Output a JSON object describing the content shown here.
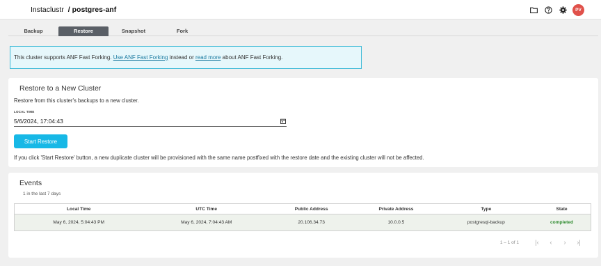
{
  "header": {
    "brand": "Instaclustr",
    "separator": "/",
    "cluster_name": "postgres-anf",
    "avatar_initials": "PV",
    "icons": [
      "folder-icon",
      "help-icon",
      "gear-icon"
    ]
  },
  "tabs": [
    {
      "label": "Backup",
      "active": false
    },
    {
      "label": "Restore",
      "active": true
    },
    {
      "label": "Snapshot",
      "active": false
    },
    {
      "label": "Fork",
      "active": false
    }
  ],
  "banner": {
    "text_1": "This cluster supports ANF Fast Forking. ",
    "link_1": "Use ANF Fast Forking",
    "text_2": " instead or ",
    "link_2": "read more",
    "text_3": " about ANF Fast Forking."
  },
  "restore": {
    "title": "Restore to a New Cluster",
    "subtitle": "Restore from this cluster's backups to a new cluster.",
    "time_label": "LOCAL TIME",
    "time_value": "5/6/2024, 17:04:43",
    "button_label": "Start Restore",
    "note": "If you click 'Start Restore' button, a new duplicate cluster will be provisioned with the same name postfixed with the restore date and the existing cluster will not be affected."
  },
  "events": {
    "title": "Events",
    "subtitle": "1 in the last 7 days",
    "columns": [
      "Local Time",
      "UTC Time",
      "Public Address",
      "Private Address",
      "Type",
      "State"
    ],
    "rows": [
      [
        "May 6, 2024, 5:04:43 PM",
        "May 6, 2024, 7:04:43 AM",
        "20.106.34.73",
        "10.0.0.5",
        "postgresql-backup",
        "completed"
      ]
    ],
    "pagination": {
      "range": "1 – 1 of 1"
    }
  },
  "colors": {
    "accent": "#17b8e6",
    "banner_border": "#39b8d6",
    "avatar": "#e0514a",
    "state_completed": "#2e8b2e"
  }
}
